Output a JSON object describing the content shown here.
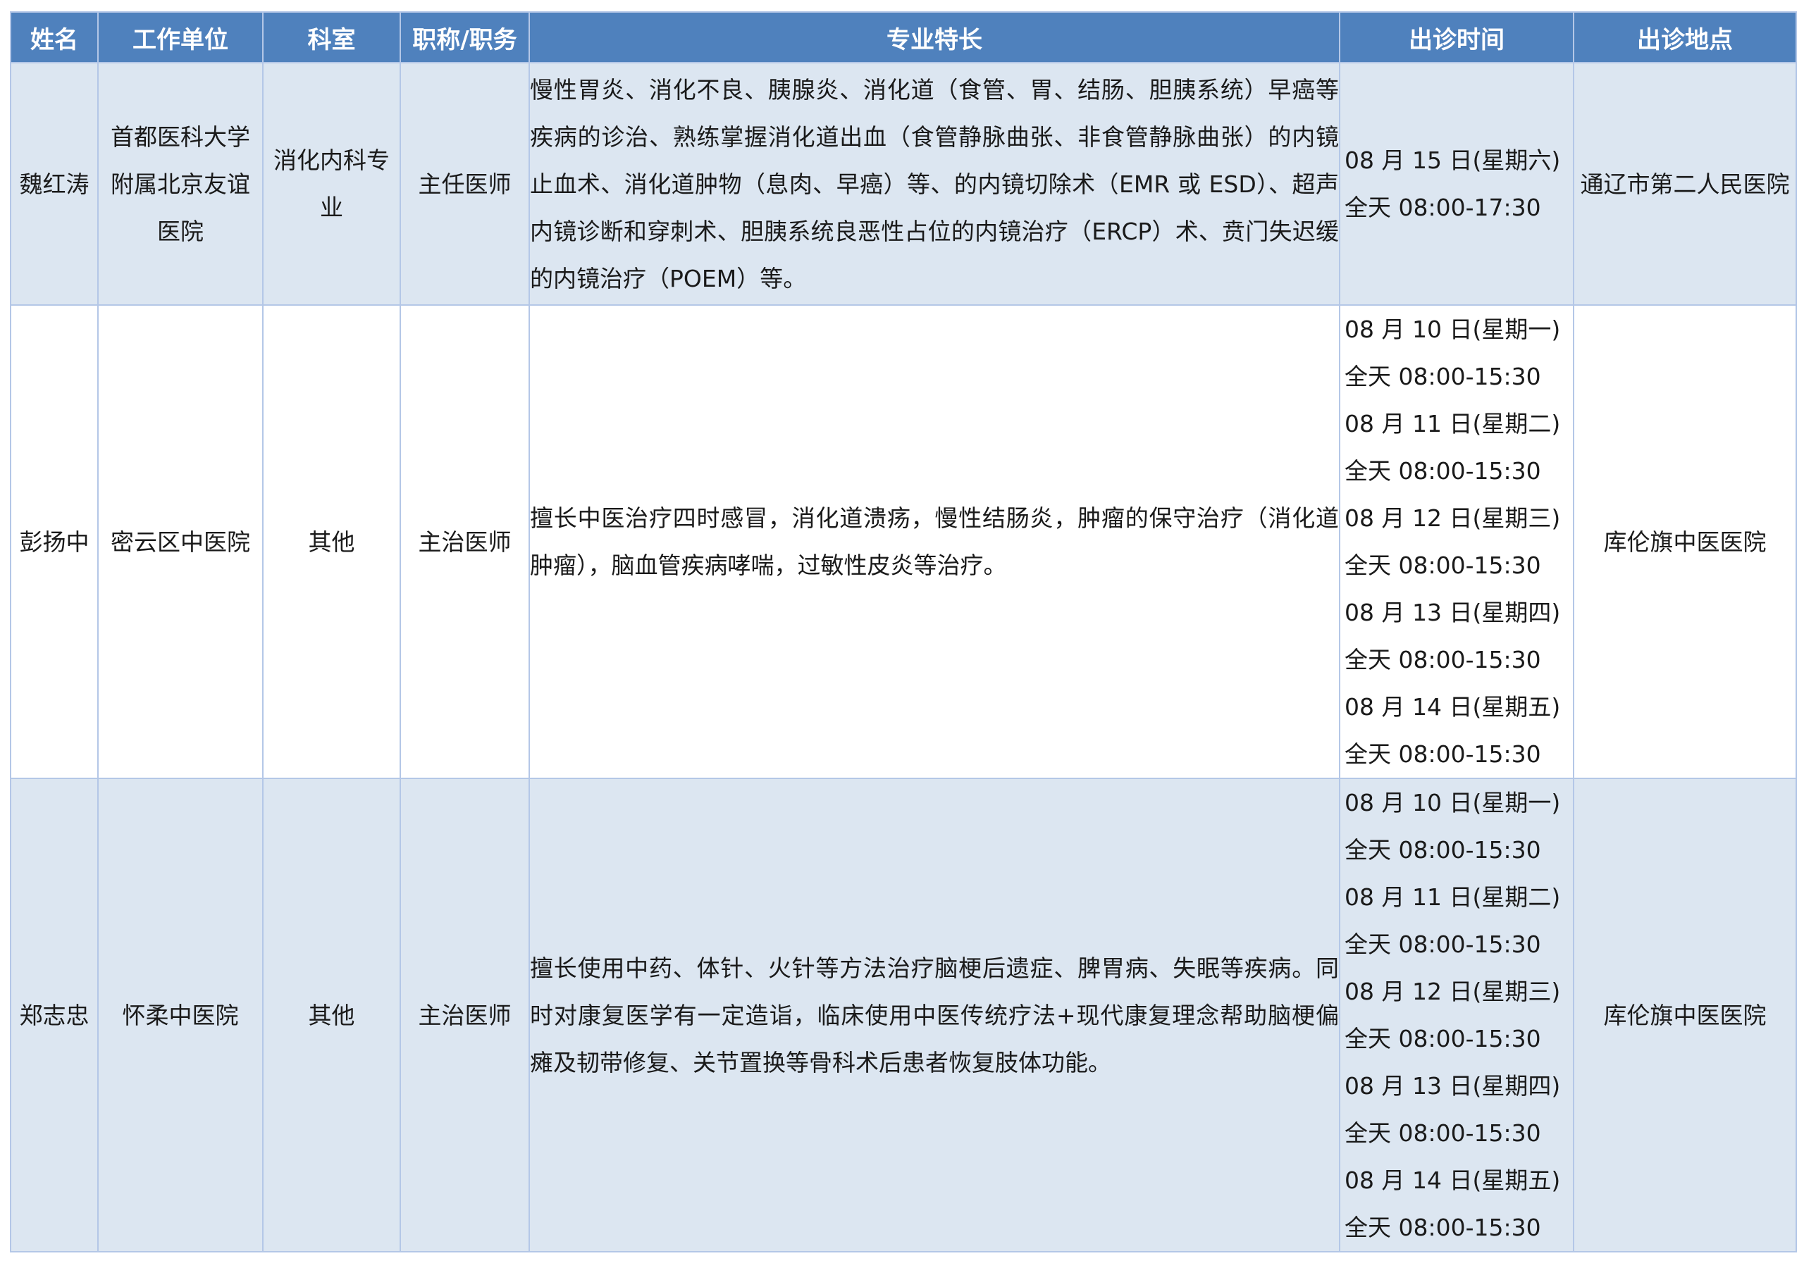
{
  "table": {
    "headers": [
      "姓名",
      "工作单位",
      "科室",
      "职称/职务",
      "专业特长",
      "出诊时间",
      "出诊地点"
    ],
    "rows": [
      {
        "name": "魏红涛",
        "unit": "首都医科大学附属北京友谊医院",
        "dept": "消化内科专业",
        "title": "主任医师",
        "specialty": "慢性胃炎、消化不良、胰腺炎、消化道（食管、胃、结肠、胆胰系统）早癌等疾病的诊治、熟练掌握消化道出血（食管静脉曲张、非食管静脉曲张）的内镜止血术、消化道肿物（息肉、早癌）等、的内镜切除术（EMR 或 ESD）、超声内镜诊断和穿刺术、胆胰系统良恶性占位的内镜治疗（ERCP）术、贲门失迟缓的内镜治疗（POEM）等。",
        "times": [
          "08 月 15 日(星期六)",
          "全天 08:00-17:30"
        ],
        "location": "通辽市第二人民医院"
      },
      {
        "name": "彭扬中",
        "unit": "密云区中医院",
        "dept": "其他",
        "title": "主治医师",
        "specialty": "擅长中医治疗四时感冒，消化道溃疡，慢性结肠炎，肿瘤的保守治疗（消化道肿瘤），脑血管疾病哮喘，过敏性皮炎等治疗。",
        "times": [
          "08 月 10 日(星期一)",
          "全天 08:00-15:30",
          "08 月 11 日(星期二)",
          "全天 08:00-15:30",
          "08 月 12 日(星期三)",
          "全天 08:00-15:30",
          "08 月 13 日(星期四)",
          "全天 08:00-15:30",
          "08 月 14 日(星期五)",
          "全天 08:00-15:30"
        ],
        "location": "库伦旗中医医院"
      },
      {
        "name": "郑志忠",
        "unit": "怀柔中医院",
        "dept": "其他",
        "title": "主治医师",
        "specialty": "擅长使用中药、体针、火针等方法治疗脑梗后遗症、脾胃病、失眠等疾病。同时对康复医学有一定造诣，临床使用中医传统疗法+现代康复理念帮助脑梗偏瘫及韧带修复、关节置换等骨科术后患者恢复肢体功能。",
        "times": [
          "08 月 10 日(星期一)",
          "全天 08:00-15:30",
          "08 月 11 日(星期二)",
          "全天 08:00-15:30",
          "08 月 12 日(星期三)",
          "全天 08:00-15:30",
          "08 月 13 日(星期四)",
          "全天 08:00-15:30",
          "08 月 14 日(星期五)",
          "全天 08:00-15:30"
        ],
        "location": "库伦旗中医医院"
      }
    ]
  }
}
